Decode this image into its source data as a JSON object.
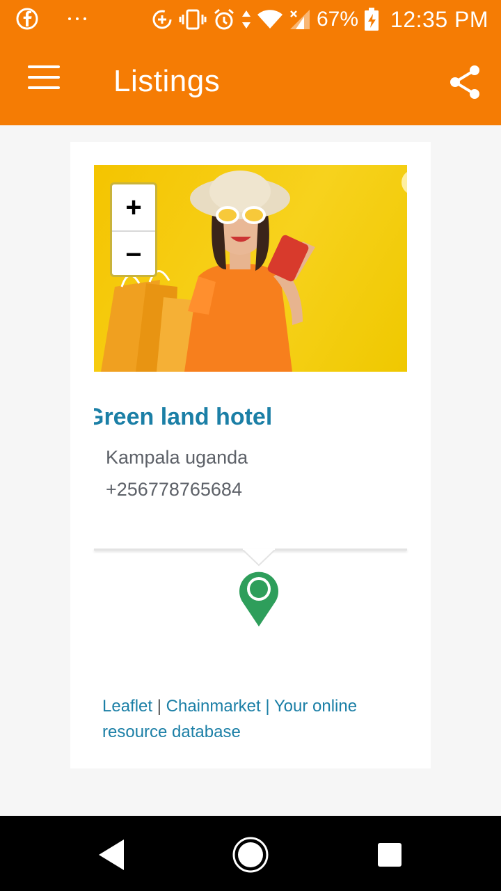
{
  "status_bar": {
    "time": "12:35 PM",
    "battery_percent": "67%",
    "icons": [
      "facebook-icon",
      "more-dots-icon",
      "data-saver-icon",
      "vibrate-icon",
      "alarm-icon",
      "data-arrows-icon",
      "wifi-icon",
      "cell-signal-icon",
      "battery-charging-icon"
    ]
  },
  "app_bar": {
    "title": "Listings",
    "menu_icon": "hamburger-menu-icon",
    "share_icon": "share-icon"
  },
  "listing": {
    "name": "Green land hotel",
    "location": "Kampala uganda",
    "phone": "+256778765684",
    "image": "woman-shopping-photo"
  },
  "map": {
    "zoom_in_label": "+",
    "zoom_out_label": "−",
    "marker_color": "#2e9e5b",
    "attribution": {
      "leaflet": "Leaflet",
      "separator": "|",
      "site": "Chainmarket | Your online resource database"
    }
  },
  "nav_bar": {
    "icons": [
      "back-icon",
      "home-icon",
      "recents-icon"
    ]
  },
  "colors": {
    "accent": "#f57c04",
    "link": "#1b7fa6",
    "text_secondary": "#5d6168"
  }
}
